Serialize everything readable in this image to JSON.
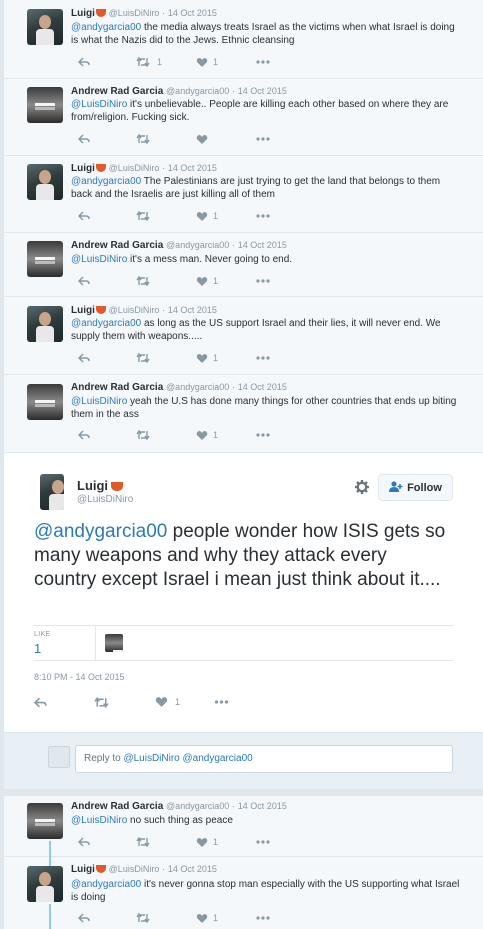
{
  "tweets_above": [
    {
      "name": "Luigi",
      "handle": "@LuisDiNiro",
      "date": "14 Oct 2015",
      "avatar": "luigi",
      "mention": "@andygarcia00",
      "text": " the media always treats Israel as the victims when what Israel is doing is what the Nazis did to the Jews. Ethnic cleansing",
      "retweets": "1",
      "likes": "1"
    },
    {
      "name": "Andrew Rad Garcia",
      "handle": "@andygarcia00",
      "date": "14 Oct 2015",
      "avatar": "andy",
      "mention": "@LuisDiNiro",
      "text": " it's unbelievable.. People are killing each other based on where they are from/religion. Fucking sick.",
      "retweets": "",
      "likes": ""
    },
    {
      "name": "Luigi",
      "handle": "@LuisDiNiro",
      "date": "14 Oct 2015",
      "avatar": "luigi",
      "mention": "@andygarcia00",
      "text": " The Palestinians are just trying to get the land that belongs to them back and the Israelis are just killing all of them",
      "retweets": "",
      "likes": "1"
    },
    {
      "name": "Andrew Rad Garcia",
      "handle": "@andygarcia00",
      "date": "14 Oct 2015",
      "avatar": "andy",
      "mention": "@LuisDiNiro",
      "text": " it's a mess man. Never going to end.",
      "retweets": "",
      "likes": "1"
    },
    {
      "name": "Luigi",
      "handle": "@LuisDiNiro",
      "date": "14 Oct 2015",
      "avatar": "luigi",
      "mention": "@andygarcia00",
      "text": " as long as the US support Israel and their lies, it will never end. We supply them with weapons.....",
      "retweets": "",
      "likes": "1"
    },
    {
      "name": "Andrew Rad Garcia",
      "handle": "@andygarcia00",
      "date": "14 Oct 2015",
      "avatar": "andy",
      "mention": "@LuisDiNiro",
      "text": " yeah the U.S has done many things for other countries that ends up biting them in the ass",
      "retweets": "",
      "likes": "1"
    }
  ],
  "main_tweet": {
    "name": "Luigi",
    "handle": "@LuisDiNiro",
    "follow_label": "Follow",
    "mention": "@andygarcia00",
    "text": " people wonder how ISIS gets so many weapons and why they attack every country except Israel i mean just think about it....",
    "likes_label": "LIKE",
    "likes_count": "1",
    "timestamp": "8:10 PM - 14 Oct 2015",
    "action_likes": "1"
  },
  "reply": {
    "prefix": "Reply to ",
    "mentions": "@LuisDiNiro @andygarcia00"
  },
  "tweets_below": [
    {
      "name": "Andrew Rad Garcia",
      "handle": "@andygarcia00",
      "date": "14 Oct 2015",
      "avatar": "andy",
      "mention": "@LuisDiNiro",
      "text": " no such thing as peace",
      "retweets": "",
      "likes": "1"
    },
    {
      "name": "Luigi",
      "handle": "@LuisDiNiro",
      "date": "14 Oct 2015",
      "avatar": "luigi",
      "mention": "@andygarcia00",
      "text": " it's never gonna stop man especially with the US supporting what Israel is doing",
      "retweets": "",
      "likes": "1"
    }
  ],
  "colors": {
    "link": "#2b7bb9",
    "muted": "#8899a6",
    "thread": "#8ecbf2"
  }
}
